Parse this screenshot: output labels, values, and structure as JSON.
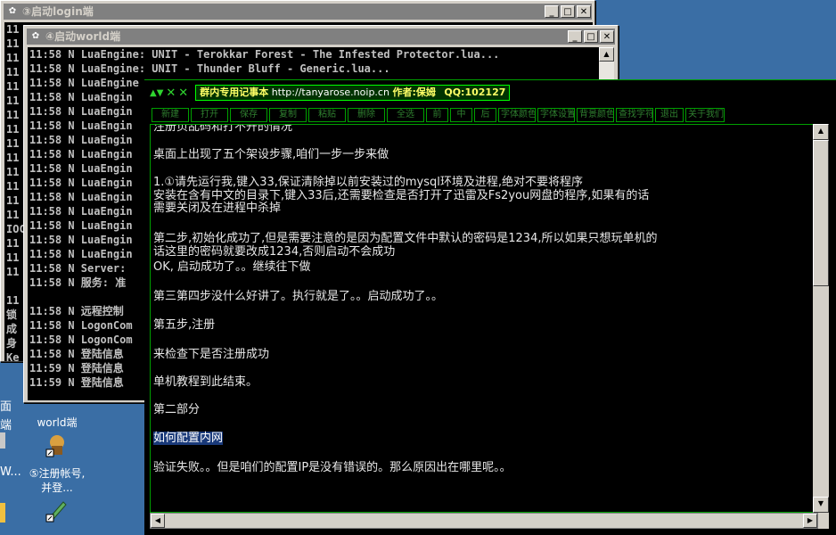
{
  "windows": {
    "login": {
      "title": "③启动login端"
    },
    "world": {
      "title": "④启动world端",
      "lines": [
        "11:58 N LuaEngine: UNIT - Terokkar Forest - The Infested Protector.lua...",
        "11:58 N LuaEngine: UNIT - Thunder Bluff - Generic.lua...",
        "11:58 N LuaEngine",
        "11:58 N LuaEngin",
        "11:58 N LuaEngin",
        "11:58 N LuaEngin",
        "11:58 N LuaEngin",
        "11:58 N LuaEngin",
        "11:58 N LuaEngin",
        "11:58 N LuaEngin",
        "11:58 N LuaEngin",
        "11:58 N LuaEngin",
        "11:58 N LuaEngin",
        "11:58 N LuaEngin",
        "11:58 N LuaEngin",
        "11:58 N Server:",
        "11:58 N 服务: 准",
        "",
        "11:58 N 远程控制",
        "11:58 N LogonCom",
        "11:58 N LogonCom",
        "11:58 N 登陆信息",
        "11:59 N 登陆信息",
        "11:59 N 登陆信息"
      ]
    },
    "login_lines": [
      "11",
      "11",
      "11",
      "11",
      "11",
      "11",
      "11",
      "11",
      "11",
      "11",
      "11",
      "11",
      "11",
      "11",
      "IOC",
      "11",
      "11",
      "11",
      "",
      "11",
      "锁",
      "成",
      "身",
      "Ke",
      "11",
      "11"
    ]
  },
  "desktop": {
    "icons": [
      {
        "label": "world端",
        "name": "world-icon"
      },
      {
        "label": "⑤注册帐号,并登...",
        "name": "register-icon"
      }
    ],
    "edge_labels": [
      "面",
      "端",
      "W..."
    ]
  },
  "notepad": {
    "title_controls": [
      "▲▼",
      "✕",
      "✕"
    ],
    "caption_bold": "群内专用记事本",
    "caption_url": "http://tanyarose.noip.cn",
    "caption_author": "作者:保姆",
    "caption_qq": "QQ:102127",
    "toolbar": [
      "新建",
      "打开",
      "保存",
      "复制",
      "粘贴",
      "删除",
      "全选",
      "前",
      "中",
      "后",
      "字体颜色",
      "字体设置",
      "背景颜色",
      "查找字符",
      "退出",
      "关于我们"
    ],
    "lines": [
      "注册页乱码和打不开的情况",
      "桌面上出现了五个架设步骤,咱们一步一步来做",
      "1.①请先运行我,键入33,保证清除掉以前安装过的mysql环境及进程,绝对不要将程序",
      "安装在含有中文的目录下,键入33后,还需要检查是否打开了迅雷及Fs2you网盘的程序,如果有的话",
      "需要关闭及在进程中杀掉",
      "第二步,初始化成功了,但是需要注意的是因为配置文件中默认的密码是1234,所以如果只想玩单机的",
      "话这里的密码就要改成1234,否则启动不会成功",
      "OK, 启动成功了。。继续往下做",
      "第三第四步没什么好讲了。执行就是了。。启动成功了。。",
      "第五步,注册",
      "来检查下是否注册成功",
      "单机教程到此结束。",
      "第二部分",
      "如何配置内网",
      "验证失败。。但是咱们的配置IP是没有错误的。那么原因出在哪里呢。。"
    ]
  },
  "colors": {
    "desktop": "#3a6ea5",
    "accent_green": "#00a000",
    "selection": "#1a3a7a"
  }
}
